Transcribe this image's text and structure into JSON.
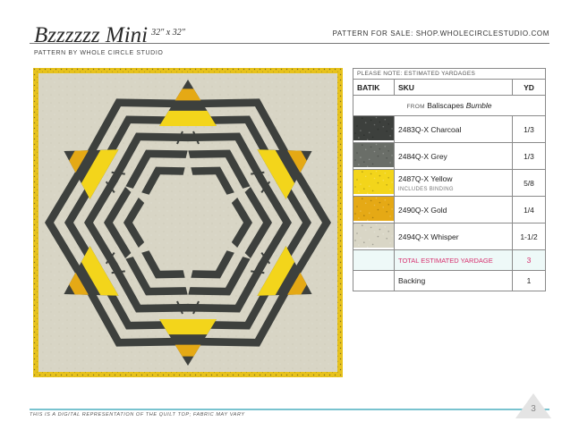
{
  "header": {
    "title": "Bzzzzzz Mini",
    "size": "32″ x 32″",
    "sale_text": "PATTERN FOR SALE: SHOP.WHOLECIRCLESTUDIO.COM",
    "byline": "PATTERN BY WHOLE CIRCLE STUDIO"
  },
  "yardage": {
    "note": "PLEASE NOTE: ESTIMATED YARDAGES",
    "col_batik": "BATIK",
    "col_sku": "SKU",
    "col_yd": "YD",
    "from_prefix": "FROM",
    "collection": "Baliscapes",
    "collection_italic": "Bumble",
    "rows": [
      {
        "sku": "2483Q-X Charcoal",
        "sub": "",
        "yd": "1/3",
        "color": "#3d403d"
      },
      {
        "sku": "2484Q-X Grey",
        "sub": "",
        "yd": "1/3",
        "color": "#6a6e68"
      },
      {
        "sku": "2487Q-X Yellow",
        "sub": "INCLUDES BINDING",
        "yd": "5/8",
        "color": "#f3d51b"
      },
      {
        "sku": "2490Q-X Gold",
        "sub": "",
        "yd": "1/4",
        "color": "#e5a915"
      },
      {
        "sku": "2494Q-X Whisper",
        "sub": "",
        "yd": "1-1/2",
        "color": "#d9d6c6"
      }
    ],
    "total_label": "TOTAL ESTIMATED YARDAGE",
    "total_value": "3",
    "backing_label": "Backing",
    "backing_value": "1"
  },
  "quilt_colors": {
    "border": "#e7c21c",
    "background": "#d8d5c5",
    "charcoal": "#3d403d",
    "yellow": "#f3d51b",
    "gold": "#e5a915"
  },
  "footer": {
    "note": "THIS IS A DIGITAL REPRESENTATION OF THE QUILT TOP; FABRIC MAY VARY",
    "page_number": "3"
  }
}
